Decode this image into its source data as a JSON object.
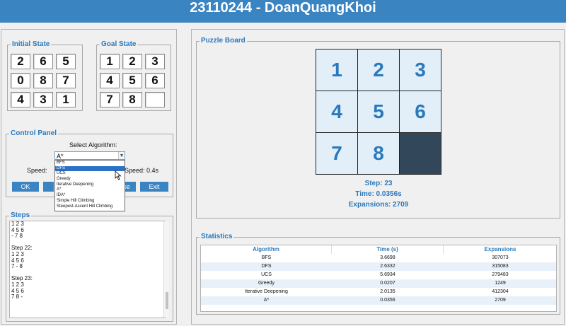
{
  "window": {
    "title": "23110244 - DoanQuangKhoi"
  },
  "initial_state": {
    "title": "Initial State",
    "cells": [
      "2",
      "6",
      "5",
      "0",
      "8",
      "7",
      "4",
      "3",
      "1"
    ]
  },
  "goal_state": {
    "title": "Goal State",
    "cells": [
      "1",
      "2",
      "3",
      "4",
      "5",
      "6",
      "7",
      "8",
      ""
    ]
  },
  "control_panel": {
    "title": "Control Panel",
    "select_label": "Select Algorithm:",
    "selected_algorithm": "A*",
    "speed_label": "Speed:",
    "speed_value_label": "Speed: 0.4s",
    "dropdown_options": [
      "BFS",
      "DFS",
      "UCS",
      "Greedy",
      "Iterative Deepening",
      "A*",
      "IDA*",
      "Simple Hill Climbing",
      "Steepest-Ascent Hill Climbing"
    ],
    "dropdown_highlighted": "DFS",
    "buttons": {
      "ok": "OK",
      "pause": "Pause",
      "exit": "Exit"
    }
  },
  "steps": {
    "title": "Steps",
    "text": "1 2 3\n4 5 6\n- 7 8\n\nStep 22:\n1 2 3\n4 5 6\n7 - 8\n\nStep 23:\n1 2 3\n4 5 6\n7 8 -"
  },
  "puzzle_board": {
    "title": "Puzzle Board",
    "tiles": [
      "1",
      "2",
      "3",
      "4",
      "5",
      "6",
      "7",
      "8",
      ""
    ],
    "step": "Step: 23",
    "time": "Time: 0.0356s",
    "expansions": "Expansions: 2709"
  },
  "statistics": {
    "title": "Statistics",
    "headers": [
      "Algorithm",
      "Time (s)",
      "Expansions"
    ],
    "rows": [
      [
        "BFS",
        "3.6698",
        "307073"
      ],
      [
        "DFS",
        "2.6332",
        "315083"
      ],
      [
        "UCS",
        "5.6934",
        "279483"
      ],
      [
        "Greedy",
        "0.0207",
        "1249"
      ],
      [
        "Iterative Deepening",
        "2.0135",
        "412304"
      ],
      [
        "A*",
        "0.0356",
        "2709"
      ]
    ]
  },
  "colors": {
    "accent": "#3a84c2",
    "tile_bg": "#e2eef8",
    "empty_tile": "#33475b",
    "row_alt": "#e8f1fa"
  }
}
